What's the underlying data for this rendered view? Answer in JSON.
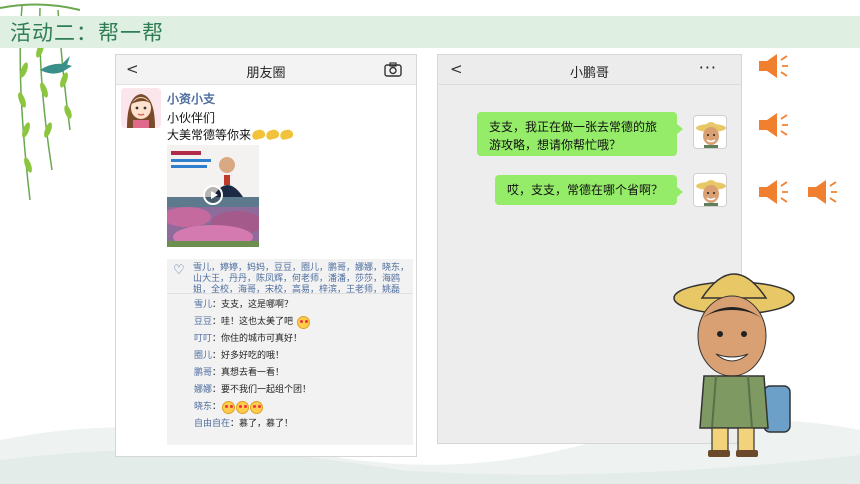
{
  "slide": {
    "title": "活动二：帮一帮"
  },
  "moments": {
    "nav_title": "朋友圈",
    "back_glyph": "<",
    "author": "小资小支",
    "line1": "小伙伴们",
    "line2": "大美常德等你来",
    "likes": "雪儿，婷婷，妈妈，豆豆，圈儿，鹏哥，娜娜，晓东，山大王，丹丹，陈凤辉，何老师，潘潘，莎莎，海鸥姐，全校，海哥，宋校，高易，梓滨，王老师，姚磊",
    "comments": [
      {
        "name": "雪儿",
        "text": "支支，这是哪啊？",
        "emoji_count": 0
      },
      {
        "name": "豆豆",
        "text": "哇！这也太美了吧",
        "emoji_count": 1
      },
      {
        "name": "叮叮",
        "text": "你住的城市可真好！",
        "emoji_count": 0
      },
      {
        "name": "圈儿",
        "text": "好多好吃的哦！",
        "emoji_count": 0
      },
      {
        "name": "鹏哥",
        "text": "真想去看一看！",
        "emoji_count": 0
      },
      {
        "name": "娜娜",
        "text": "要不我们一起组个团！",
        "emoji_count": 0
      },
      {
        "name": "晓东",
        "text": "",
        "emoji_count": 3
      },
      {
        "name": "自由自在",
        "text": "慕了，慕了！",
        "emoji_count": 0
      }
    ]
  },
  "chat": {
    "nav_title": "小鹏哥",
    "back_glyph": "<",
    "more_glyph": "···",
    "messages": [
      {
        "text": "支支，我正在做一张去常德的旅游攻略，想请你帮忙哦？"
      },
      {
        "text": "哎，支支，常德在哪个省啊？"
      }
    ]
  },
  "colors": {
    "title_bar": "#dff0e3",
    "title_text": "#2f7d54",
    "bubble": "#95ec69",
    "name_blue": "#4d6d9e",
    "speaker": "#f08030"
  },
  "icons": [
    "speaker-icon",
    "camera-icon",
    "heart-icon",
    "play-icon",
    "more-icon",
    "back-icon"
  ]
}
